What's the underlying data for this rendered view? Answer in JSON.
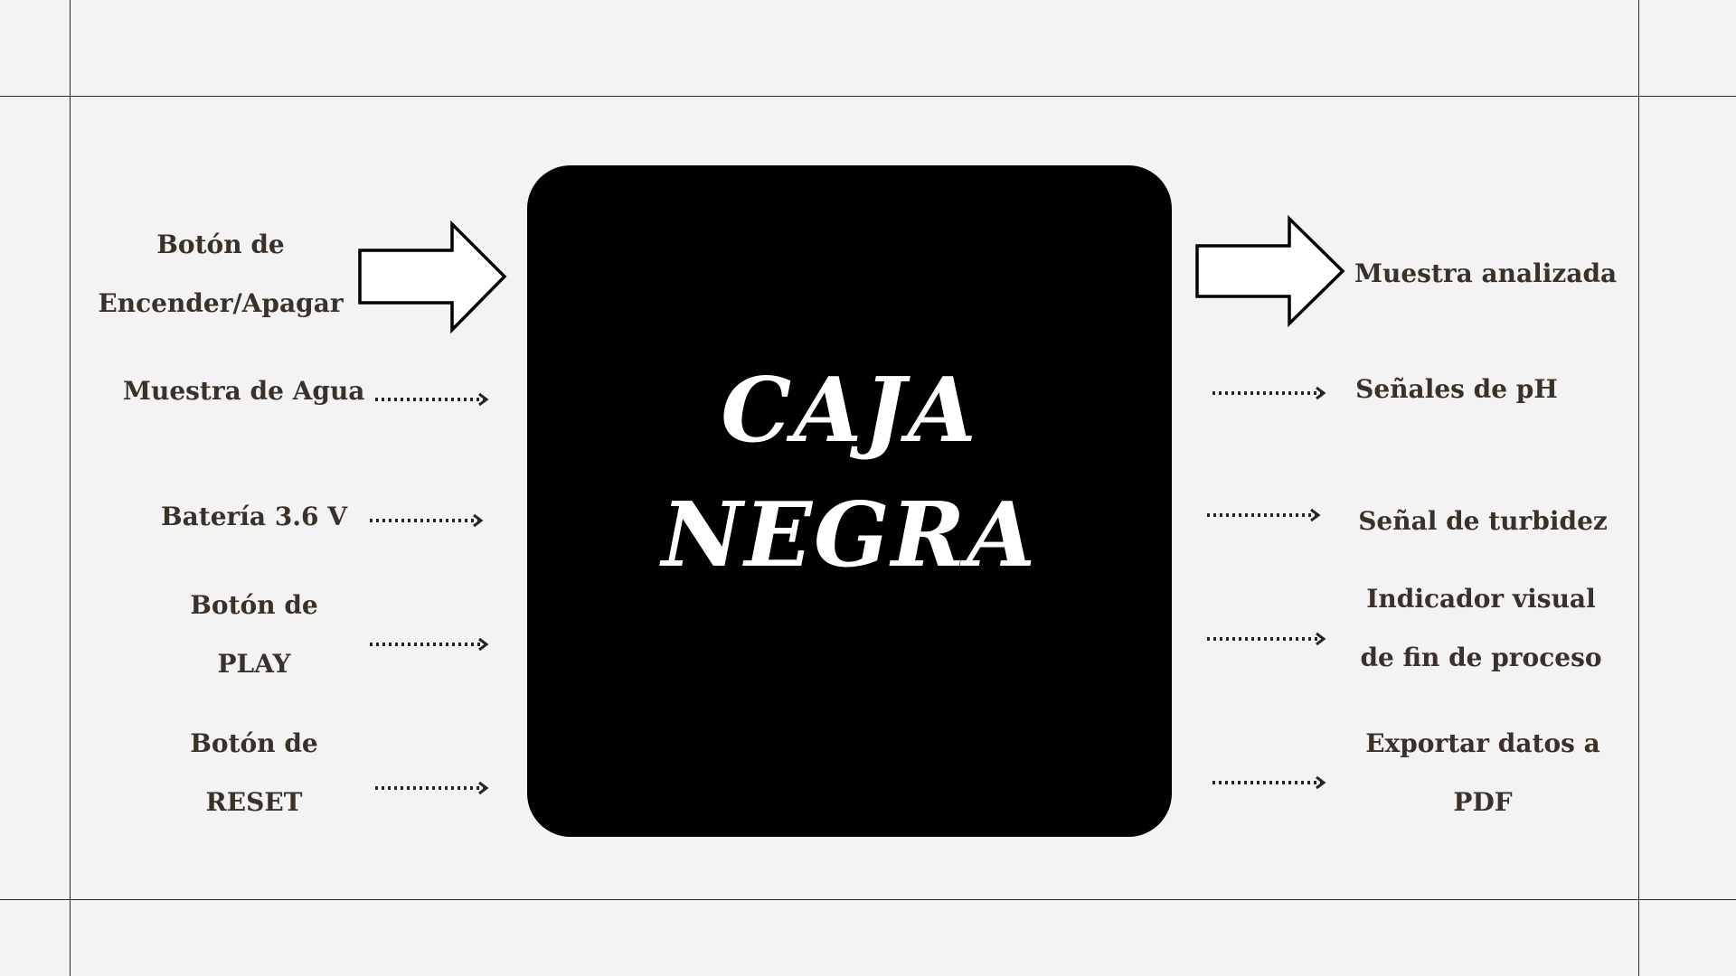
{
  "title_lines": [
    "CAJA",
    "NEGRA"
  ],
  "inputs": {
    "power_lines": [
      "Botón de",
      "Encender/Apagar"
    ],
    "water_sample": "Muestra de Agua",
    "battery": "Batería 3.6 V",
    "play_lines": [
      "Botón de",
      "PLAY"
    ],
    "reset_lines": [
      "Botón de",
      "RESET"
    ]
  },
  "outputs": {
    "analyzed_sample": "Muestra analizada",
    "ph_signals": "Señales de pH",
    "turbidity_signal": "Señal de turbidez",
    "indicator_lines": [
      "Indicador visual",
      "de fin de proceso"
    ],
    "export_lines": [
      "Exportar datos a",
      "PDF"
    ]
  },
  "colors": {
    "background": "#f3f3f3",
    "box": "#000000",
    "text": "#3a3129",
    "box_text": "#ffffff"
  }
}
